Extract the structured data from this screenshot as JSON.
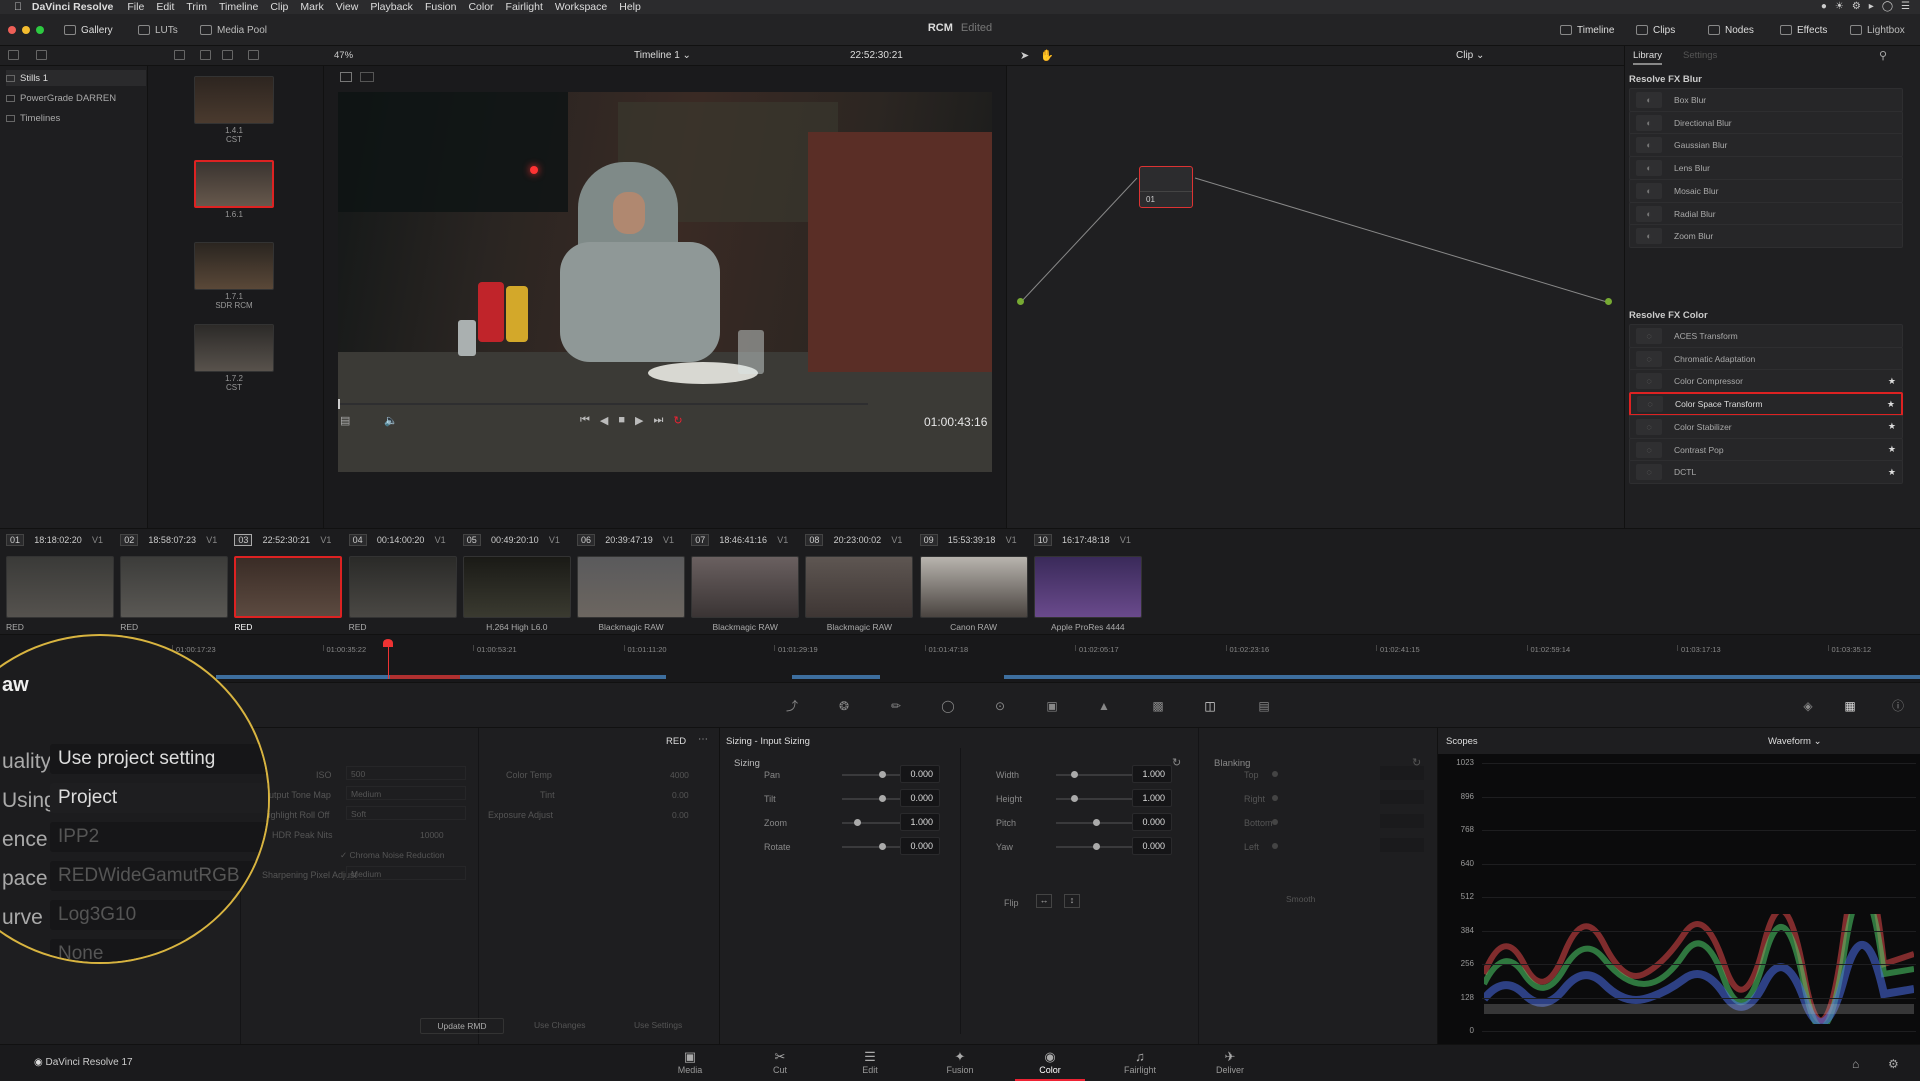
{
  "menubar": {
    "app": "DaVinci Resolve",
    "items": [
      "File",
      "Edit",
      "Trim",
      "Timeline",
      "Clip",
      "Mark",
      "View",
      "Playback",
      "Fusion",
      "Color",
      "Fairlight",
      "Workspace",
      "Help"
    ]
  },
  "titlebar": {
    "tabs": [
      "Gallery",
      "LUTs",
      "Media Pool"
    ],
    "project": "RCM",
    "status": "Edited",
    "right_tabs": [
      "Timeline",
      "Clips",
      "Nodes",
      "Effects",
      "Lightbox"
    ]
  },
  "toolbar": {
    "zoom": "47%",
    "timeline": "Timeline 1",
    "timecode": "22:52:30:21",
    "mode": "Clip"
  },
  "gallery": {
    "items": [
      "Stills 1",
      "PowerGrade DARREN",
      "Timelines"
    ]
  },
  "stills": [
    {
      "id": "1.4.1",
      "sub": "CST"
    },
    {
      "id": "1.6.1",
      "sub": ""
    },
    {
      "id": "1.7.1",
      "sub": "SDR RCM"
    },
    {
      "id": "1.7.2",
      "sub": "CST"
    }
  ],
  "viewer": {
    "timecode": "01:00:43:16"
  },
  "node": {
    "label": "01"
  },
  "library": {
    "tabs": [
      "Library",
      "Settings"
    ],
    "blur_title": "Resolve FX Blur",
    "blur": [
      "Box Blur",
      "Directional Blur",
      "Gaussian Blur",
      "Lens Blur",
      "Mosaic Blur",
      "Radial Blur",
      "Zoom Blur"
    ],
    "color_title": "Resolve FX Color",
    "color": [
      "ACES Transform",
      "Chromatic Adaptation",
      "Color Compressor",
      "Color Space Transform",
      "Color Stabilizer",
      "Contrast Pop",
      "DCTL"
    ]
  },
  "clips": [
    {
      "n": "01",
      "tc": "18:18:02:20",
      "track": "V1",
      "codec": "RED"
    },
    {
      "n": "02",
      "tc": "18:58:07:23",
      "track": "V1",
      "codec": "RED"
    },
    {
      "n": "03",
      "tc": "22:52:30:21",
      "track": "V1",
      "codec": "RED"
    },
    {
      "n": "04",
      "tc": "00:14:00:20",
      "track": "V1",
      "codec": "RED"
    },
    {
      "n": "05",
      "tc": "00:49:20:10",
      "track": "V1",
      "codec": "H.264 High L6.0"
    },
    {
      "n": "06",
      "tc": "20:39:47:19",
      "track": "V1",
      "codec": "Blackmagic RAW"
    },
    {
      "n": "07",
      "tc": "18:46:41:16",
      "track": "V1",
      "codec": "Blackmagic RAW"
    },
    {
      "n": "08",
      "tc": "20:23:00:02",
      "track": "V1",
      "codec": "Blackmagic RAW"
    },
    {
      "n": "09",
      "tc": "15:53:39:18",
      "track": "V1",
      "codec": "Canon RAW"
    },
    {
      "n": "10",
      "tc": "16:17:48:18",
      "track": "V1",
      "codec": "Apple ProRes 4444"
    }
  ],
  "ruler": [
    "01:00:17:23",
    "01:00:35:22",
    "01:00:53:21",
    "01:01:11:20",
    "01:01:29:19",
    "01:01:47:18",
    "01:02:05:17",
    "01:02:23:16",
    "01:02:41:15",
    "01:02:59:14",
    "01:03:17:13",
    "01:03:35:12"
  ],
  "raw": {
    "header": "RED",
    "iso_lbl": "ISO",
    "iso": "500",
    "tonemap_lbl": "Output Tone Map",
    "tonemap": "Medium",
    "rolloff_lbl": "Highlight Roll Off",
    "rolloff": "Soft",
    "peak_lbl": "HDR Peak Nits",
    "peak": "10000",
    "chroma": "Chroma Noise Reduction",
    "sharp_lbl": "Sharpening Pixel Adjust",
    "sharp": "Medium",
    "temp_lbl": "Color Temp",
    "temp": "4000",
    "tint_lbl": "Tint",
    "tint": "0.00",
    "exp_lbl": "Exposure Adjust",
    "exp": "0.00",
    "btn_update": "Update RMD",
    "btn_use": "Use Changes",
    "btn_settings": "Use Settings"
  },
  "magnifier": {
    "title": "aw",
    "rows": [
      {
        "l": "uality",
        "v": "Use project setting"
      },
      {
        "l": "Using",
        "v": "Project"
      },
      {
        "l": "ence",
        "v": "IPP2"
      },
      {
        "l": "pace",
        "v": "REDWideGamutRGB"
      },
      {
        "l": "urve",
        "v": "Log3G10"
      },
      {
        "l": "",
        "v": "None"
      }
    ]
  },
  "sizing": {
    "header": "Sizing - Input Sizing",
    "title": "Sizing",
    "blanking": "Blanking",
    "left": [
      {
        "l": "Pan",
        "v": "0.000"
      },
      {
        "l": "Tilt",
        "v": "0.000"
      },
      {
        "l": "Zoom",
        "v": "1.000"
      },
      {
        "l": "Rotate",
        "v": "0.000"
      }
    ],
    "right": [
      {
        "l": "Width",
        "v": "1.000"
      },
      {
        "l": "Height",
        "v": "1.000"
      },
      {
        "l": "Pitch",
        "v": "0.000"
      },
      {
        "l": "Yaw",
        "v": "0.000"
      }
    ],
    "flip": "Flip",
    "blank": [
      "Top",
      "Right",
      "Bottom",
      "Left"
    ],
    "smooth": "Smooth"
  },
  "scopes": {
    "title": "Scopes",
    "mode": "Waveform",
    "scale": [
      "1023",
      "896",
      "768",
      "640",
      "512",
      "384",
      "256",
      "128",
      "0"
    ]
  },
  "footer": {
    "app": "DaVinci Resolve 17",
    "pages": [
      "Media",
      "Cut",
      "Edit",
      "Fusion",
      "Color",
      "Fairlight",
      "Deliver"
    ],
    "active": "Color"
  }
}
